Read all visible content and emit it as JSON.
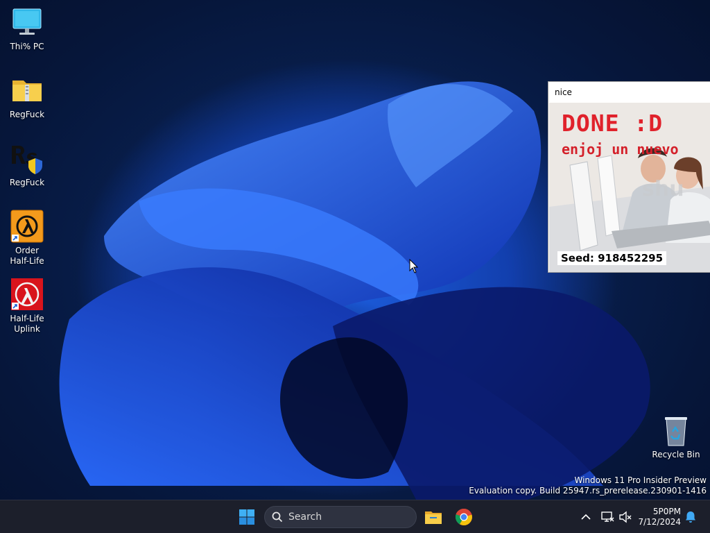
{
  "desktop": {
    "icons": [
      {
        "label": "Thi% PC",
        "icon": "computer-icon"
      },
      {
        "label": "RegFuck",
        "icon": "zip-folder-icon"
      },
      {
        "label": "RegFuck",
        "icon": "rs-shield-icon"
      },
      {
        "label": "Order\nHalf-Life",
        "icon": "half-life-orange-icon"
      },
      {
        "label": "Half-Life\nUplink",
        "icon": "half-life-red-icon"
      }
    ],
    "recycle_bin": {
      "label": "Recycle Bin",
      "icon": "recycle-bin-icon"
    }
  },
  "window": {
    "title": "nice",
    "headline": "DONE :D",
    "subline": "enjoj un nuevo",
    "seed": "Seed: 918452295"
  },
  "watermark": {
    "line1": "Windows 11 Pro Insider Preview",
    "line2": "Evaluation copy. Build 25947.rs_prerelease.230901-1416"
  },
  "taskbar": {
    "search_placeholder": "Search",
    "start_icon": "windows-start-icon",
    "pinned": [
      "file-explorer-icon",
      "chrome-icon"
    ],
    "tray": [
      "chevron-up-icon",
      "network-icon",
      "volume-muted-icon",
      "notification-bell-icon"
    ],
    "time": "5P0PM",
    "date": "7/12/2024"
  },
  "colors": {
    "accent": "#1d5fe0",
    "taskbar": "#1c1f2b",
    "headline_red": "#e0212b"
  }
}
